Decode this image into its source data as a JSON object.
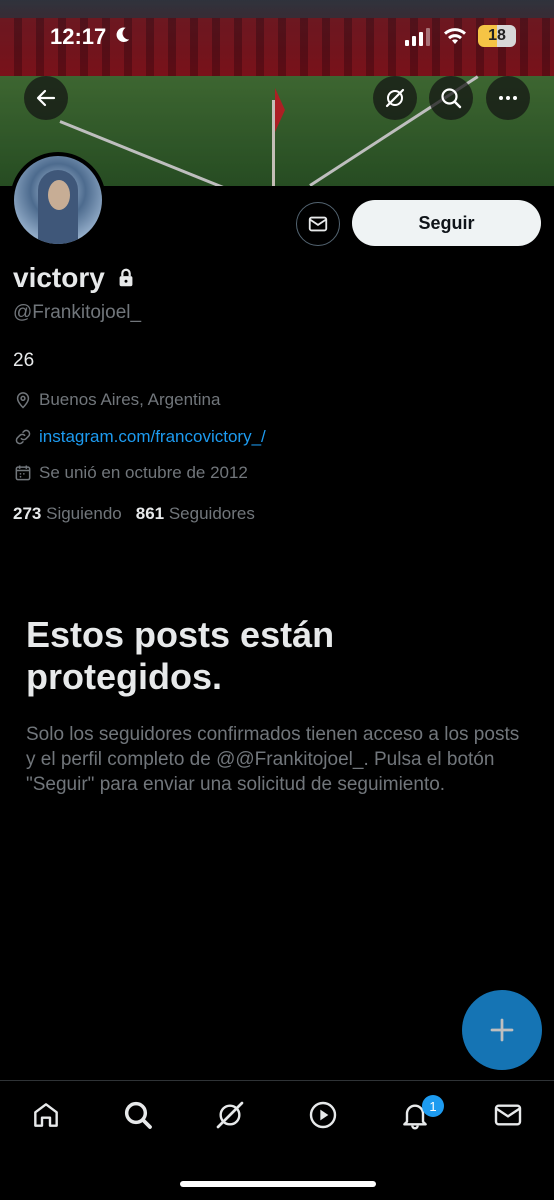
{
  "status_bar": {
    "time": "12:17",
    "battery": "18"
  },
  "profile": {
    "name": "victory",
    "handle": "@Frankitojoel_",
    "bio": "26",
    "location": "Buenos Aires, Argentina",
    "link": "instagram.com/francovictory_/",
    "joined": "Se unió en octubre de 2012",
    "following_count": "273",
    "following_label": "Siguiendo",
    "followers_count": "861",
    "followers_label": "Seguidores"
  },
  "actions": {
    "follow_label": "Seguir"
  },
  "protected": {
    "title": "Estos posts están protegidos.",
    "description": "Solo los seguidores confirmados tienen acceso a los posts y el perfil completo de @@Frankitojoel_. Pulsa el botón \"Seguir\" para enviar una solicitud de seguimiento."
  },
  "nav": {
    "notification_badge": "1"
  },
  "colors": {
    "accent": "#1d9bf0",
    "background": "#000000",
    "secondary_text": "#71767b"
  }
}
